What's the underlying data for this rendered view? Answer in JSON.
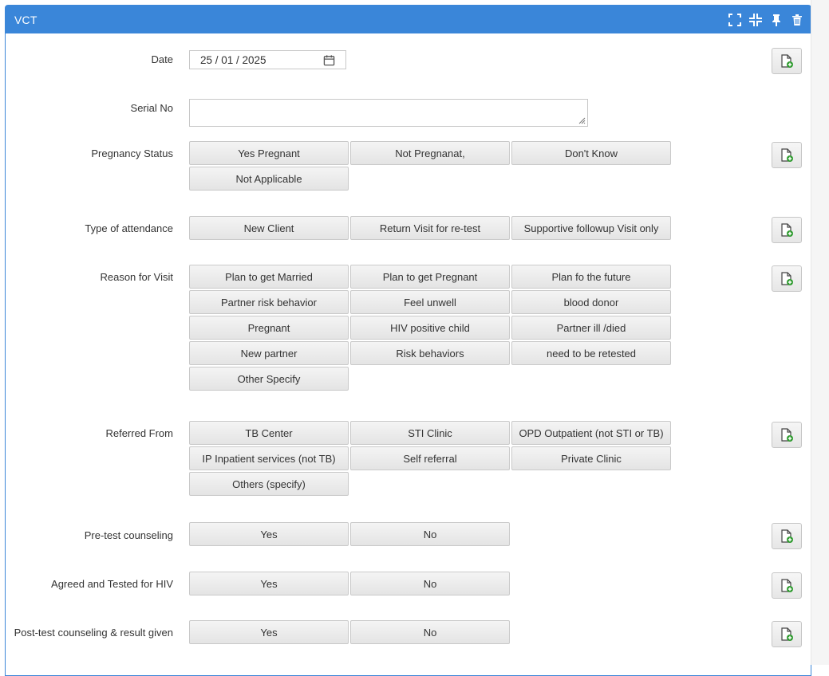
{
  "panel": {
    "title": "VCT",
    "header_icons": [
      "fullscreen-icon",
      "collapse-icon",
      "pin-icon",
      "trash-icon"
    ]
  },
  "fields": {
    "date": {
      "label": "Date",
      "value": "25 / 01 / 2025"
    },
    "serial": {
      "label": "Serial No",
      "value": ""
    },
    "pregnancy": {
      "label": "Pregnancy Status",
      "options": [
        "Yes Pregnant",
        "Not Pregnanat,",
        "Don't Know",
        "Not Applicable"
      ]
    },
    "attendance": {
      "label": "Type of attendance",
      "options": [
        "New Client",
        "Return Visit for re-test",
        "Supportive followup Visit only"
      ]
    },
    "reason": {
      "label": "Reason for Visit",
      "options": [
        "Plan to get Married",
        "Plan to get Pregnant",
        "Plan fo the future",
        "Partner risk behavior",
        "Feel unwell",
        "blood donor",
        "Pregnant",
        "HIV positive child",
        "Partner ill /died",
        "New partner",
        "Risk behaviors",
        "need to be retested",
        "Other Specify"
      ]
    },
    "referred": {
      "label": "Referred From",
      "options": [
        "TB Center",
        "STI Clinic",
        "OPD Outpatient (not STI or TB)",
        "IP Inpatient services (not TB)",
        "Self referral",
        "Private Clinic",
        "Others (specify)"
      ]
    },
    "pretest": {
      "label": "Pre-test counseling",
      "options": [
        "Yes",
        "No"
      ]
    },
    "agreed": {
      "label": "Agreed and Tested for HIV",
      "options": [
        "Yes",
        "No"
      ]
    },
    "posttest": {
      "label": "Post-test counseling & result given",
      "options": [
        "Yes",
        "No"
      ]
    }
  },
  "icons": {
    "add_attachment": "file-add-icon",
    "calendar": "calendar-icon",
    "accent_green": "#2e9b2e",
    "header_blue": "#3a86d9"
  }
}
